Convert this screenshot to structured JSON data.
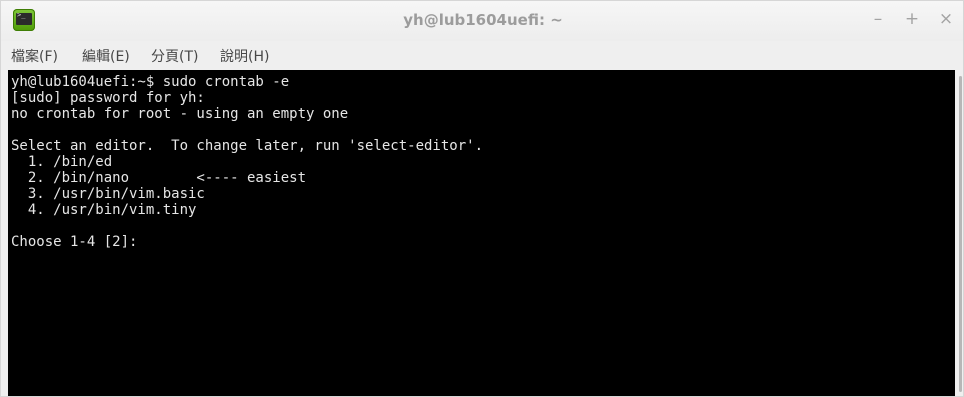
{
  "window": {
    "title": "yh@lub1604uefi: ~",
    "buttons": {
      "minimize": "–",
      "maximize": "+",
      "close": "×"
    },
    "icon_name": "terminal-icon",
    "icon_glyph": ">_"
  },
  "menu": {
    "items": [
      {
        "label": "檔案(F)"
      },
      {
        "label": "編輯(E)"
      },
      {
        "label": "分頁(T)"
      },
      {
        "label": "說明(H)"
      }
    ]
  },
  "terminal": {
    "lines": [
      "yh@lub1604uefi:~$ sudo crontab -e",
      "[sudo] password for yh:",
      "no crontab for root - using an empty one",
      "",
      "Select an editor.  To change later, run 'select-editor'.",
      "  1. /bin/ed",
      "  2. /bin/nano        <---- easiest",
      "  3. /usr/bin/vim.basic",
      "  4. /usr/bin/vim.tiny",
      "",
      "Choose 1-4 [2]: "
    ]
  },
  "colors": {
    "terminal_bg": "#000000",
    "terminal_fg": "#e6e6e6",
    "titlebar_bg": "#efefef",
    "icon_green": "#4e9a06"
  }
}
